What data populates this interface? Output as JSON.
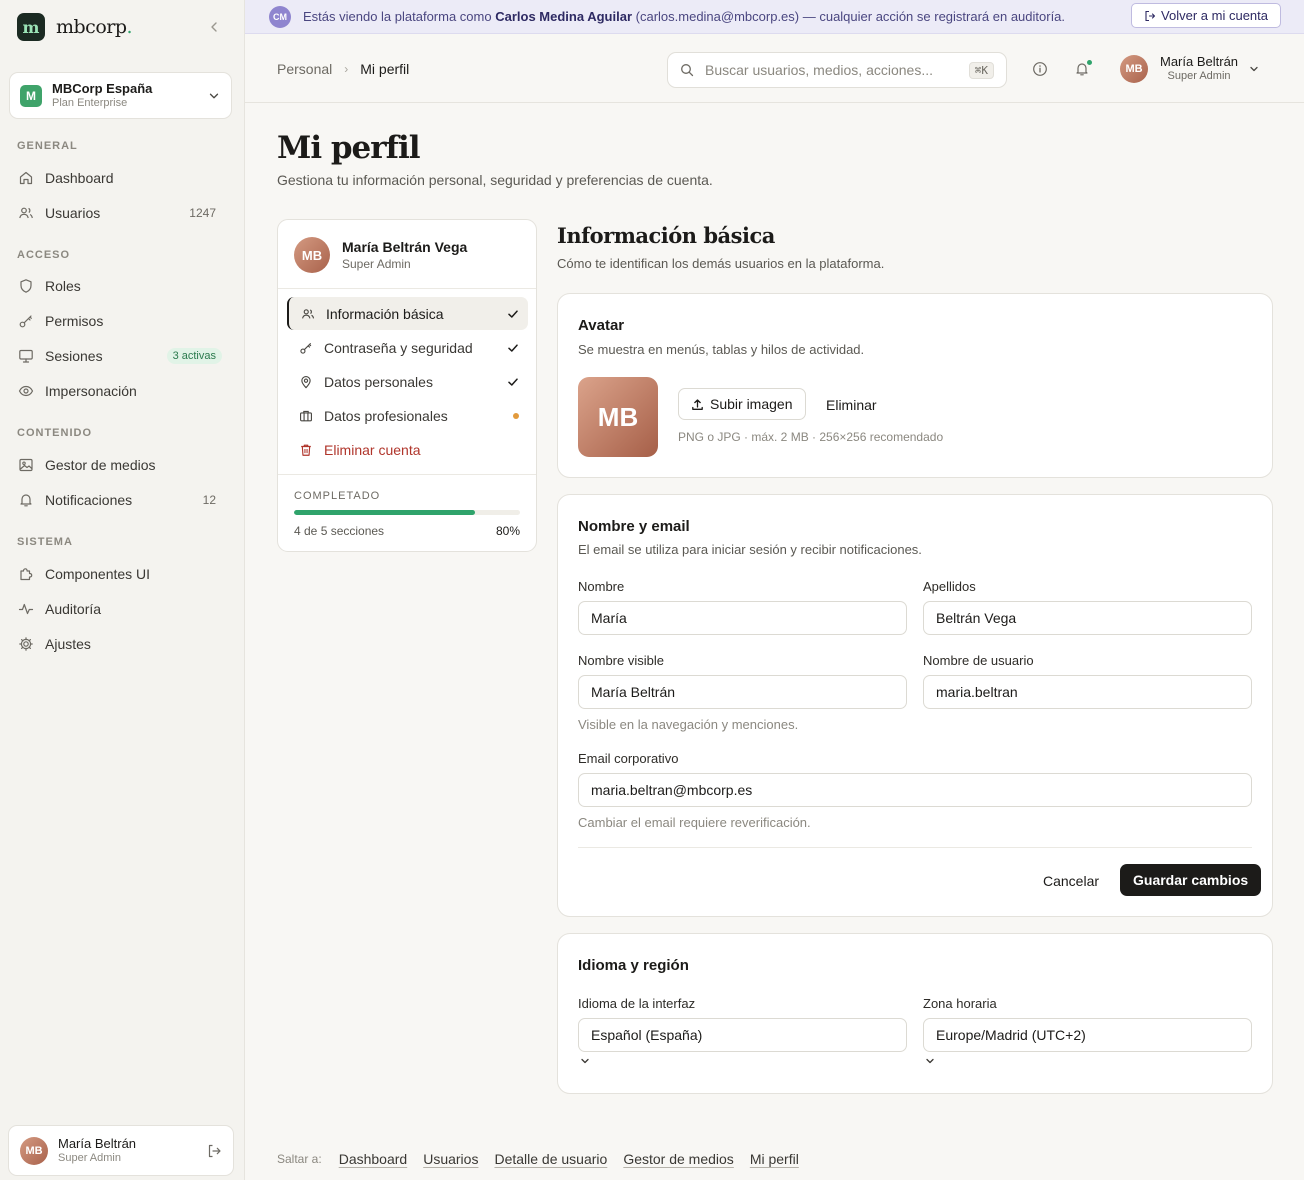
{
  "brand": {
    "name": "mbcorp",
    "dot": ".",
    "mark": "m"
  },
  "org": {
    "logo": "M",
    "name": "MBCorp España",
    "plan": "Plan Enterprise"
  },
  "sidebar": {
    "sections": [
      {
        "title": "GENERAL"
      },
      {
        "title": "ACCESO"
      },
      {
        "title": "CONTENIDO"
      },
      {
        "title": "SISTEMA"
      }
    ],
    "items": [
      {
        "label": "Dashboard",
        "icon": "home-icon"
      },
      {
        "label": "Usuarios",
        "icon": "users-icon",
        "count": "1247"
      },
      {
        "label": "Roles",
        "icon": "shield-icon"
      },
      {
        "label": "Permisos",
        "icon": "key-icon"
      },
      {
        "label": "Sesiones",
        "icon": "monitor-icon",
        "badge": "3 activas"
      },
      {
        "label": "Impersonación",
        "icon": "eye-icon"
      },
      {
        "label": "Gestor de medios",
        "icon": "image-icon"
      },
      {
        "label": "Notificaciones",
        "icon": "bell-icon",
        "count": "12"
      },
      {
        "label": "Componentes UI",
        "icon": "puzzle-icon"
      },
      {
        "label": "Auditoría",
        "icon": "activity-icon"
      },
      {
        "label": "Ajustes",
        "icon": "gear-icon"
      }
    ],
    "user": {
      "initials": "MB",
      "name": "María Beltrán",
      "role": "Super Admin"
    }
  },
  "banner": {
    "initials": "CM",
    "prefix": "Estás viendo la plataforma como",
    "name": "Carlos Medina Aguilar",
    "suffix": "(carlos.medina@mbcorp.es) — cualquier acción se registrará en auditoría.",
    "button": "Volver a mi cuenta"
  },
  "header": {
    "breadcrumb": [
      "Personal",
      "Mi perfil"
    ],
    "search": {
      "placeholder": "Buscar usuarios, medios, acciones...",
      "shortcut": "⌘K"
    },
    "user": {
      "initials": "MB",
      "name": "María Beltrán",
      "role": "Super Admin"
    }
  },
  "page": {
    "title": "Mi perfil",
    "subtitle": "Gestiona tu información personal, seguridad y preferencias de cuenta."
  },
  "profile_nav": {
    "initials": "MB",
    "name": "María Beltrán Vega",
    "role": "Super Admin",
    "items": [
      {
        "label": "Información básica",
        "status": "done"
      },
      {
        "label": "Contraseña y seguridad",
        "status": "done"
      },
      {
        "label": "Datos personales",
        "status": "done"
      },
      {
        "label": "Datos profesionales",
        "status": "pending"
      },
      {
        "label": "Eliminar cuenta",
        "status": "danger"
      }
    ],
    "completion": {
      "label": "COMPLETADO",
      "sections": "4 de 5 secciones",
      "percent_label": "80%",
      "percent": 80
    }
  },
  "section": {
    "title": "Información básica",
    "subtitle": "Cómo te identifican los demás usuarios en la plataforma."
  },
  "avatar_card": {
    "title": "Avatar",
    "subtitle": "Se muestra en menús, tablas y hilos de actividad.",
    "initials": "MB",
    "upload": "Subir imagen",
    "remove": "Eliminar",
    "hint": "PNG o JPG · máx. 2 MB · 256×256 recomendado"
  },
  "name_card": {
    "title": "Nombre y email",
    "subtitle": "El email se utiliza para iniciar sesión y recibir notificaciones.",
    "fields": {
      "first_name": {
        "label": "Nombre",
        "value": "María"
      },
      "last_name": {
        "label": "Apellidos",
        "value": "Beltrán Vega"
      },
      "display_name": {
        "label": "Nombre visible",
        "value": "María Beltrán",
        "hint": "Visible en la navegación y menciones."
      },
      "username": {
        "label": "Nombre de usuario",
        "value": "maria.beltran"
      },
      "email": {
        "label": "Email corporativo",
        "value": "maria.beltran@mbcorp.es",
        "hint": "Cambiar el email requiere reverificación."
      }
    },
    "cancel": "Cancelar",
    "save": "Guardar cambios"
  },
  "region_card": {
    "title": "Idioma y región",
    "language": {
      "label": "Idioma de la interfaz",
      "value": "Español (España)"
    },
    "timezone": {
      "label": "Zona horaria",
      "value": "Europe/Madrid (UTC+2)"
    }
  },
  "jump": {
    "label": "Saltar a:",
    "links": [
      "Dashboard",
      "Usuarios",
      "Detalle de usuario",
      "Gestor de medios",
      "Mi perfil"
    ]
  },
  "colors": {
    "accent": "#2fa36b",
    "primary": "#1c1b19",
    "danger": "#b0352b",
    "banner_bg": "#ecebf7",
    "pending": "#e29a3c"
  }
}
